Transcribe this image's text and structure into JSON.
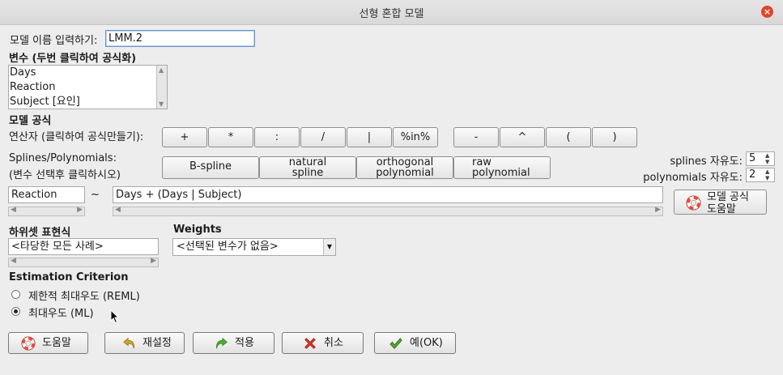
{
  "window": {
    "title": "선형 혼합 모델",
    "close": "×"
  },
  "model_name": {
    "label": "모델 이름 입력하기:",
    "value": "LMM.2"
  },
  "variables": {
    "header": "변수 (두번 클릭하여 공식화)",
    "items": [
      "Days",
      "Reaction",
      "Subject [요인]"
    ]
  },
  "formula": {
    "header": "모델 공식",
    "operators_label": "연산자 (클릭하여 공식만들기):",
    "operators": [
      "+",
      "*",
      ":",
      "/",
      "|",
      "%in%",
      "-",
      "^",
      "(",
      ")"
    ],
    "splines_label_1": "Splines/Polynomials:",
    "splines_label_2": "(변수 선택후 클릭하시오)",
    "spline_buttons": [
      [
        "B-spline"
      ],
      [
        "natural",
        "spline"
      ],
      [
        "orthogonal",
        "polynomial"
      ],
      [
        "raw",
        "polynomial"
      ]
    ],
    "splines_df_label": "splines 자유도:",
    "splines_df_value": "5",
    "poly_df_label": "polynomials 자유도:",
    "poly_df_value": "2",
    "lhs": "Reaction",
    "tilde": "~",
    "rhs": "Days + (Days | Subject)",
    "help_button": [
      "모델 공식",
      "도움말"
    ]
  },
  "subset": {
    "header": "하위셋 표현식",
    "value": "<타당한 모든 사례>"
  },
  "weights": {
    "header": "Weights",
    "value": "<선택된 변수가 없음>"
  },
  "estimation": {
    "header": "Estimation Criterion",
    "options": [
      "제한적 최대우도 (REML)",
      "최대우도 (ML)"
    ],
    "selected": "최대우도 (ML)"
  },
  "buttons": {
    "help": "도움말",
    "reset": "재설정",
    "apply": "적용",
    "cancel": "취소",
    "ok": "예(OK)"
  },
  "colors": {
    "title_bg": "#dcdcdc",
    "dialog_bg": "#ededed",
    "close": "#e0452a",
    "ok_check": "#5aa02c",
    "cancel_x": "#d9352b"
  }
}
